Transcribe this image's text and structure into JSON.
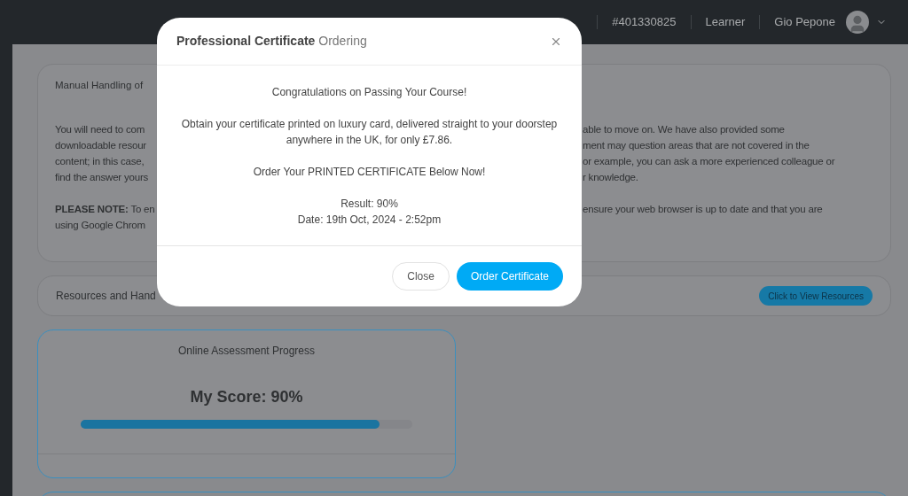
{
  "top_bar": {
    "items": [
      "#401330825",
      "Learner"
    ],
    "user_name": "Gio Pepone"
  },
  "intro_card": {
    "title": "Manual Handling of",
    "paragraphs": [
      [
        {
          "left": "You will need to com",
          "right": "able to move on. We have also provided some"
        },
        {
          "left": "downloadable resour",
          "right": "ment may question areas that are not covered in the"
        },
        {
          "left": "content; in this case,",
          "right": "or example, you can ask a more experienced colleague or"
        },
        {
          "left": "find the answer yours",
          "right": "r knowledge."
        }
      ],
      [
        {
          "left": "**PLEASE NOTE:** To en",
          "right": "ensure your web browser is up to date and that you are"
        },
        {
          "left": "using Google Chrom"
        }
      ]
    ]
  },
  "resources_card": {
    "title": "Resources and Hand",
    "button": "Click to View Resources"
  },
  "progress_card": {
    "title": "Online Assessment Progress",
    "score": "My Score: 90%",
    "level": 0.9
  },
  "dialog": {
    "title": "**Professional Certificate** Ordering",
    "paragraphs": [
      [
        "Congratulations on Passing Your Course!"
      ],
      [
        "Obtain your certificate printed on luxury card, delivered straight to your doorstep anywhere in the UK, for only £7.86."
      ],
      [
        "Order Your PRINTED CERTIFICATE Below Now!"
      ],
      [
        "Result: 90%",
        "Date: 19th Oct, 2024 - 2:52pm"
      ]
    ],
    "buttons": [
      {
        "label": "Close",
        "kind": "secondary"
      },
      {
        "label": "Order Certificate",
        "kind": "primary"
      }
    ]
  }
}
